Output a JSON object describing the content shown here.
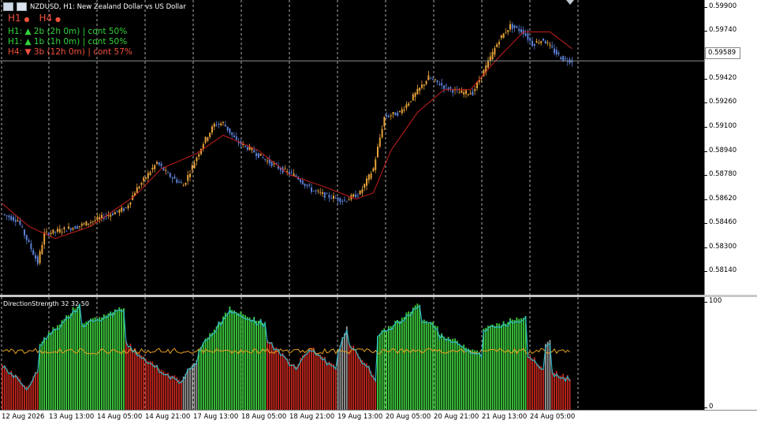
{
  "window": {
    "title": "NZDUSD, H1: New Zealand Dollar vs US Dollar",
    "icons": [
      "window-menu-icon",
      "chart-type-icon"
    ]
  },
  "overlay": {
    "tf_labels": [
      {
        "label": "H1",
        "status": "red-dot"
      },
      {
        "label": "H4",
        "status": "red-dot"
      }
    ],
    "signals": [
      {
        "text": "H1: ▲ 2b (2h 0m) | cont 50%",
        "color": "#31d43a"
      },
      {
        "text": "H1: ▲ 1b (1h 0m) | cont 50%",
        "color": "#31d43a"
      },
      {
        "text": "H4: ▼ 3b (12h 0m) | cont 57%",
        "color": "#f0503c"
      }
    ]
  },
  "price_scale": {
    "ticks": [
      "0.59900",
      "0.59740",
      "0.59580",
      "0.59420",
      "0.59260",
      "0.59100",
      "0.58940",
      "0.58780",
      "0.58620",
      "0.58460",
      "0.58300",
      "0.58140"
    ],
    "current_price": "0.59589"
  },
  "indicator": {
    "title": "DirectionStrength 32 32 50",
    "scale_ticks": [
      "100",
      "0"
    ]
  },
  "time_axis": {
    "ticks": [
      "12 Aug 2026",
      "13 Aug 13:00",
      "14 Aug 05:00",
      "14 Aug 21:00",
      "17 Aug 13:00",
      "18 Aug 05:00",
      "18 Aug 21:00",
      "19 Aug 13:00",
      "20 Aug 05:00",
      "20 Aug 21:00",
      "21 Aug 13:00",
      "24 Aug 05:00"
    ]
  },
  "colors": {
    "background": "#000000",
    "bull_candle": "#e8a23a",
    "bear_candle": "#5b7fd6",
    "moving_average": "#c81e1e",
    "strength_up": "#3fd13f",
    "strength_down": "#c8281e",
    "strength_neutral": "#9a9a9a",
    "strength_line": "#2fb8c8",
    "threshold_line": "#e8a020"
  },
  "chart_data": [
    {
      "type": "candlestick",
      "title": "NZDUSD, H1: New Zealand Dollar vs US Dollar",
      "ylim": [
        0.5805,
        0.5999
      ],
      "close_path": [
        [
          0,
          0.5858
        ],
        [
          7,
          0.5854
        ],
        [
          16,
          0.5826
        ],
        [
          19,
          0.5845
        ],
        [
          34,
          0.585
        ],
        [
          38,
          0.5852
        ],
        [
          56,
          0.5862
        ],
        [
          60,
          0.5873
        ],
        [
          70,
          0.5892
        ],
        [
          75,
          0.5884
        ],
        [
          82,
          0.5877
        ],
        [
          91,
          0.5905
        ],
        [
          96,
          0.5917
        ],
        [
          100,
          0.5918
        ],
        [
          106,
          0.5906
        ],
        [
          113,
          0.59
        ],
        [
          120,
          0.5893
        ],
        [
          127,
          0.5887
        ],
        [
          133,
          0.5883
        ],
        [
          140,
          0.5874
        ],
        [
          147,
          0.587
        ],
        [
          155,
          0.5867
        ],
        [
          162,
          0.5872
        ],
        [
          168,
          0.5888
        ],
        [
          173,
          0.5922
        ],
        [
          180,
          0.5925
        ],
        [
          187,
          0.5937
        ],
        [
          193,
          0.5948
        ],
        [
          200,
          0.5942
        ],
        [
          207,
          0.5938
        ],
        [
          213,
          0.5938
        ],
        [
          219,
          0.5955
        ],
        [
          225,
          0.5973
        ],
        [
          230,
          0.5982
        ],
        [
          236,
          0.5978
        ],
        [
          240,
          0.597
        ],
        [
          245,
          0.5973
        ],
        [
          250,
          0.5965
        ],
        [
          254,
          0.596
        ],
        [
          258,
          0.5959
        ]
      ],
      "ma_path": [
        [
          0,
          0.5865
        ],
        [
          12,
          0.585
        ],
        [
          24,
          0.5842
        ],
        [
          40,
          0.585
        ],
        [
          60,
          0.587
        ],
        [
          72,
          0.5888
        ],
        [
          88,
          0.5898
        ],
        [
          100,
          0.591
        ],
        [
          116,
          0.59
        ],
        [
          130,
          0.5884
        ],
        [
          146,
          0.5876
        ],
        [
          160,
          0.5868
        ],
        [
          168,
          0.5872
        ],
        [
          176,
          0.59
        ],
        [
          188,
          0.5925
        ],
        [
          200,
          0.594
        ],
        [
          212,
          0.594
        ],
        [
          224,
          0.596
        ],
        [
          236,
          0.5978
        ],
        [
          248,
          0.5978
        ],
        [
          258,
          0.5967
        ]
      ]
    },
    {
      "type": "bar",
      "title": "DirectionStrength 32 32 50",
      "ylim": [
        0,
        100
      ],
      "segments": [
        {
          "x": [
            0,
            12
          ],
          "from": 40,
          "to": 22,
          "color": "down"
        },
        {
          "x": [
            12,
            17
          ],
          "from": 20,
          "to": 36,
          "color": "down"
        },
        {
          "x": [
            17,
            36
          ],
          "from": 60,
          "to": 95,
          "color": "up"
        },
        {
          "x": [
            36,
            44
          ],
          "from": 75,
          "to": 82,
          "color": "up"
        },
        {
          "x": [
            44,
            56
          ],
          "from": 82,
          "to": 92,
          "color": "up"
        },
        {
          "x": [
            56,
            74
          ],
          "from": 60,
          "to": 34,
          "color": "down"
        },
        {
          "x": [
            74,
            82
          ],
          "from": 34,
          "to": 26,
          "color": "down"
        },
        {
          "x": [
            82,
            89
          ],
          "from": 30,
          "to": 44,
          "color": "neutral"
        },
        {
          "x": [
            89,
            104
          ],
          "from": 55,
          "to": 90,
          "color": "up"
        },
        {
          "x": [
            104,
            120
          ],
          "from": 88,
          "to": 78,
          "color": "up"
        },
        {
          "x": [
            120,
            133
          ],
          "from": 62,
          "to": 40,
          "color": "down"
        },
        {
          "x": [
            133,
            140
          ],
          "from": 40,
          "to": 55,
          "color": "down"
        },
        {
          "x": [
            140,
            152
          ],
          "from": 55,
          "to": 38,
          "color": "down"
        },
        {
          "x": [
            152,
            157
          ],
          "from": 55,
          "to": 72,
          "color": "neutral"
        },
        {
          "x": [
            157,
            170
          ],
          "from": 60,
          "to": 30,
          "color": "down"
        },
        {
          "x": [
            170,
            190
          ],
          "from": 66,
          "to": 94,
          "color": "up"
        },
        {
          "x": [
            190,
            198
          ],
          "from": 80,
          "to": 76,
          "color": "up"
        },
        {
          "x": [
            198,
            218
          ],
          "from": 68,
          "to": 50,
          "color": "up"
        },
        {
          "x": [
            218,
            238
          ],
          "from": 72,
          "to": 84,
          "color": "up"
        },
        {
          "x": [
            238,
            246
          ],
          "from": 50,
          "to": 38,
          "color": "down"
        },
        {
          "x": [
            246,
            249
          ],
          "from": 60,
          "to": 60,
          "color": "neutral"
        },
        {
          "x": [
            249,
            258
          ],
          "from": 35,
          "to": 28,
          "color": "down"
        }
      ],
      "level": 52
    }
  ]
}
